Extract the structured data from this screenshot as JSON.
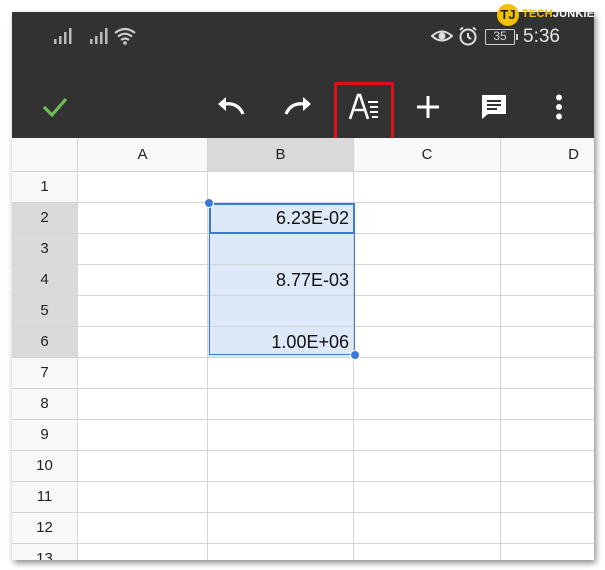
{
  "watermark": {
    "logo": "TJ",
    "part1": "TECH",
    "part2": "JUNKIE"
  },
  "status": {
    "time": "5:36",
    "battery": "35"
  },
  "toolbar": {
    "icons": [
      "checkmark-icon",
      "undo-icon",
      "redo-icon",
      "text-format-icon",
      "add-icon",
      "comment-icon",
      "more-vert-icon"
    ]
  },
  "columns": [
    "A",
    "B",
    "C",
    "D"
  ],
  "rows": [
    "1",
    "2",
    "3",
    "4",
    "5",
    "6",
    "7",
    "8",
    "9",
    "10",
    "11",
    "12",
    "13"
  ],
  "cells": {
    "B2": "6.23E-02",
    "B4": "8.77E-03",
    "B6": "1.00E+06"
  },
  "colors": {
    "bar": "#323232",
    "selection": "#3b78d8",
    "selection_fill": "#dde8f8",
    "highlight": "#e0101a",
    "check": "#6dbb5b"
  }
}
